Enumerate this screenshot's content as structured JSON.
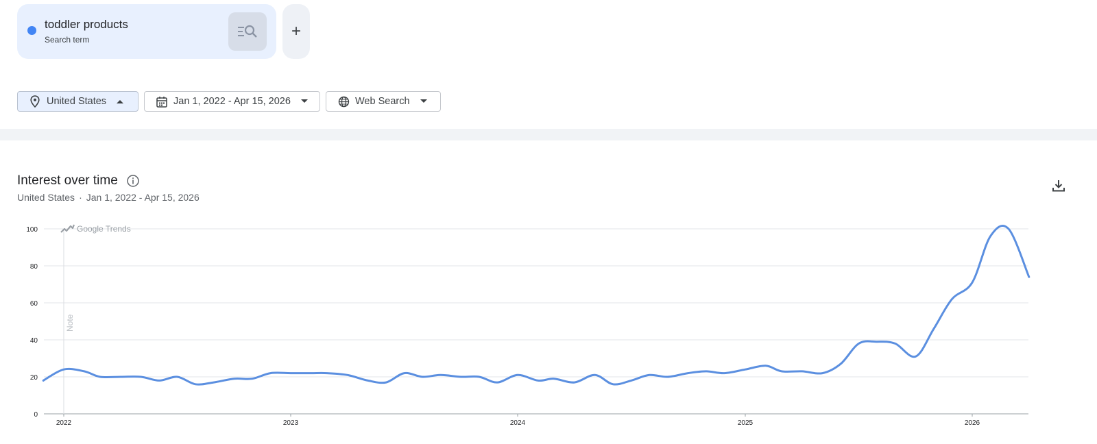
{
  "search_term": {
    "name": "toddler products",
    "type": "Search term",
    "color": "#4285f4"
  },
  "add_button": {
    "label": "+"
  },
  "filters": {
    "location": "United States",
    "date_range": "Jan 1, 2022 - Apr 15, 2026",
    "search_type": "Web Search"
  },
  "section": {
    "title": "Interest over time",
    "subtitle_location": "United States",
    "subtitle_separator": "·",
    "subtitle_range": "Jan 1, 2022 - Apr 15, 2026"
  },
  "chart_data": {
    "type": "line",
    "watermark": "Google Trends",
    "note_label": "Note",
    "ylim": [
      0,
      100
    ],
    "y_ticks": [
      "0",
      "20",
      "40",
      "60",
      "80",
      "100"
    ],
    "x_ticks": [
      "2022",
      "2023",
      "2024",
      "2025",
      "2026"
    ],
    "grid": true,
    "line_color": "#5b8fe0",
    "series": [
      {
        "x": [
          2021.91,
          2022.0,
          2022.09,
          2022.16,
          2022.25,
          2022.34,
          2022.42,
          2022.5,
          2022.58,
          2022.66,
          2022.75,
          2022.83,
          2022.91,
          2023.0,
          2023.09,
          2023.16,
          2023.25,
          2023.34,
          2023.42,
          2023.5,
          2023.58,
          2023.66,
          2023.75,
          2023.83,
          2023.91,
          2024.0,
          2024.09,
          2024.16,
          2024.25,
          2024.34,
          2024.42,
          2024.5,
          2024.58,
          2024.66,
          2024.75,
          2024.83,
          2024.91,
          2025.0,
          2025.09,
          2025.16,
          2025.25,
          2025.34,
          2025.42,
          2025.5,
          2025.58,
          2025.66,
          2025.75,
          2025.83,
          2025.91,
          2026.0,
          2026.08,
          2026.16,
          2026.25
        ],
        "values": [
          18,
          24,
          23,
          20,
          20,
          20,
          18,
          20,
          16,
          17,
          19,
          19,
          22,
          22,
          22,
          22,
          21,
          18,
          17,
          22,
          20,
          21,
          20,
          20,
          17,
          21,
          18,
          19,
          17,
          21,
          16,
          18,
          21,
          20,
          22,
          23,
          22,
          24,
          26,
          23,
          23,
          22,
          27,
          38,
          39,
          38,
          31,
          46,
          62,
          71,
          96,
          100,
          74
        ]
      }
    ]
  }
}
